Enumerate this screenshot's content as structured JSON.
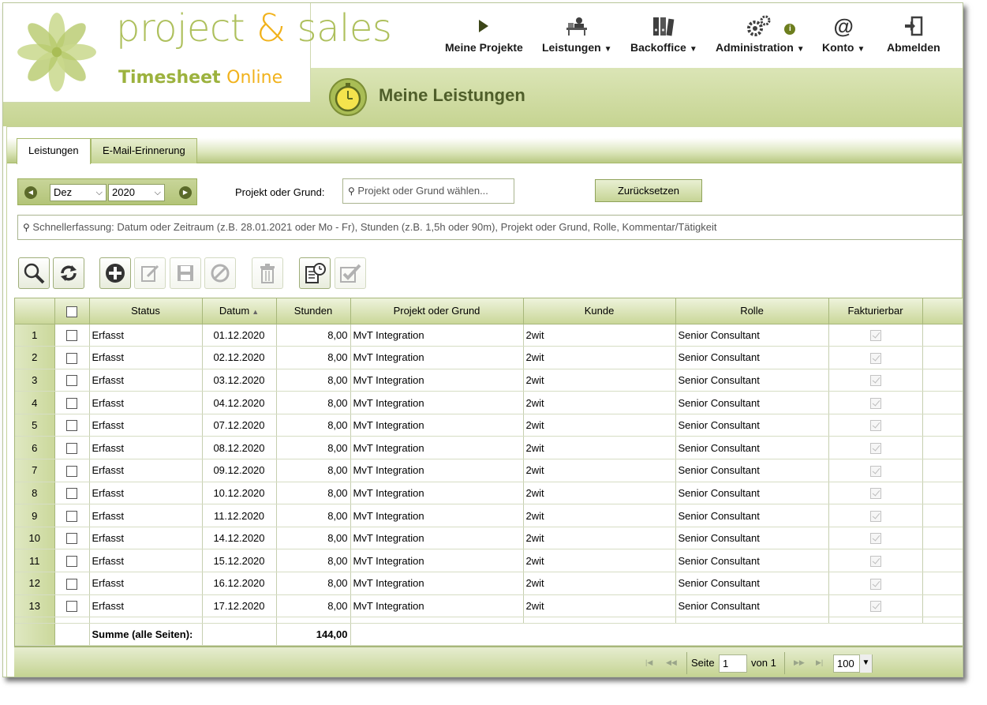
{
  "brand": {
    "title_main": "project ",
    "title_amp": "&",
    "title_end": " sales",
    "subtitle_a": "Timesheet ",
    "subtitle_b": "Online"
  },
  "nav": [
    {
      "label": "Meine Projekte",
      "icon": "play-icon",
      "has_menu": false
    },
    {
      "label": "Leistungen",
      "icon": "desk-person-icon",
      "has_menu": true
    },
    {
      "label": "Backoffice",
      "icon": "binders-icon",
      "has_menu": true
    },
    {
      "label": "Administration",
      "icon": "gears-icon",
      "has_menu": true,
      "badge": "i"
    },
    {
      "label": "Konto",
      "icon": "at-icon",
      "has_menu": true
    },
    {
      "label": "Abmelden",
      "icon": "logout-icon",
      "has_menu": false
    }
  ],
  "page_title": "Meine Leistungen",
  "tabs": [
    {
      "label": "Leistungen",
      "active": true
    },
    {
      "label": "E-Mail-Erinnerung",
      "active": false
    }
  ],
  "filters": {
    "month": "Dez",
    "year": "2020",
    "project_label": "Projekt oder Grund:",
    "project_placeholder": "Projekt oder Grund wählen...",
    "reset_label": "Zurücksetzen",
    "quick_entry_placeholder": "Schnellerfassung: Datum oder Zeitraum (z.B. 28.01.2021 oder Mo - Fr), Stunden (z.B. 1,5h oder 90m), Projekt oder Grund, Rolle, Kommentar/Tätigkeit"
  },
  "toolbar": [
    {
      "icon": "search-icon",
      "enabled": true
    },
    {
      "icon": "refresh-icon",
      "enabled": true
    },
    {
      "icon": "add-icon",
      "enabled": true
    },
    {
      "icon": "edit-icon",
      "enabled": false
    },
    {
      "icon": "save-icon",
      "enabled": false
    },
    {
      "icon": "cancel-icon",
      "enabled": false
    },
    {
      "icon": "delete-icon",
      "enabled": false
    },
    {
      "icon": "timesheet-report-icon",
      "enabled": true
    },
    {
      "icon": "approve-icon",
      "enabled": false
    }
  ],
  "table": {
    "columns": [
      "Status",
      "Datum",
      "Stunden",
      "Projekt oder Grund",
      "Kunde",
      "Rolle",
      "Fakturierbar"
    ],
    "rows": [
      {
        "n": "1",
        "status": "Erfasst",
        "date": "01.12.2020",
        "hours": "8,00",
        "project": "MvT Integration",
        "customer": "2wit",
        "role": "Senior Consultant"
      },
      {
        "n": "2",
        "status": "Erfasst",
        "date": "02.12.2020",
        "hours": "8,00",
        "project": "MvT Integration",
        "customer": "2wit",
        "role": "Senior Consultant"
      },
      {
        "n": "3",
        "status": "Erfasst",
        "date": "03.12.2020",
        "hours": "8,00",
        "project": "MvT Integration",
        "customer": "2wit",
        "role": "Senior Consultant"
      },
      {
        "n": "4",
        "status": "Erfasst",
        "date": "04.12.2020",
        "hours": "8,00",
        "project": "MvT Integration",
        "customer": "2wit",
        "role": "Senior Consultant"
      },
      {
        "n": "5",
        "status": "Erfasst",
        "date": "07.12.2020",
        "hours": "8,00",
        "project": "MvT Integration",
        "customer": "2wit",
        "role": "Senior Consultant"
      },
      {
        "n": "6",
        "status": "Erfasst",
        "date": "08.12.2020",
        "hours": "8,00",
        "project": "MvT Integration",
        "customer": "2wit",
        "role": "Senior Consultant"
      },
      {
        "n": "7",
        "status": "Erfasst",
        "date": "09.12.2020",
        "hours": "8,00",
        "project": "MvT Integration",
        "customer": "2wit",
        "role": "Senior Consultant"
      },
      {
        "n": "8",
        "status": "Erfasst",
        "date": "10.12.2020",
        "hours": "8,00",
        "project": "MvT Integration",
        "customer": "2wit",
        "role": "Senior Consultant"
      },
      {
        "n": "9",
        "status": "Erfasst",
        "date": "11.12.2020",
        "hours": "8,00",
        "project": "MvT Integration",
        "customer": "2wit",
        "role": "Senior Consultant"
      },
      {
        "n": "10",
        "status": "Erfasst",
        "date": "14.12.2020",
        "hours": "8,00",
        "project": "MvT Integration",
        "customer": "2wit",
        "role": "Senior Consultant"
      },
      {
        "n": "11",
        "status": "Erfasst",
        "date": "15.12.2020",
        "hours": "8,00",
        "project": "MvT Integration",
        "customer": "2wit",
        "role": "Senior Consultant"
      },
      {
        "n": "12",
        "status": "Erfasst",
        "date": "16.12.2020",
        "hours": "8,00",
        "project": "MvT Integration",
        "customer": "2wit",
        "role": "Senior Consultant"
      },
      {
        "n": "13",
        "status": "Erfasst",
        "date": "17.12.2020",
        "hours": "8,00",
        "project": "MvT Integration",
        "customer": "2wit",
        "role": "Senior Consultant"
      }
    ],
    "summary_label": "Summe (alle Seiten):",
    "summary_hours": "144,00"
  },
  "pager": {
    "page_label": "Seite",
    "page_value": "1",
    "of_label": "von 1",
    "page_size": "100"
  },
  "colors": {
    "accent_green": "#aec05d",
    "accent_orange": "#f1b21c",
    "header_band": "#c6d492",
    "title_text": "#4f5e2a"
  }
}
